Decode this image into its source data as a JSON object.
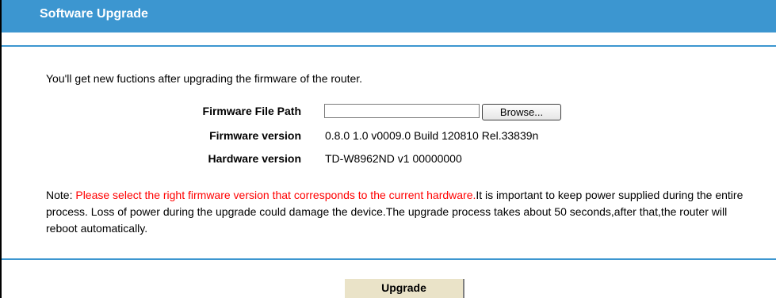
{
  "header": {
    "title": "Software Upgrade"
  },
  "intro": "You'll get new fuctions after upgrading the firmware of the router.",
  "fields": {
    "file_path": {
      "label": "Firmware File Path",
      "value": "",
      "browse_label": "Browse..."
    },
    "firmware_version": {
      "label": "Firmware version",
      "value": "0.8.0 1.0 v0009.0 Build 120810 Rel.33839n"
    },
    "hardware_version": {
      "label": "Hardware version",
      "value": "TD-W8962ND v1 00000000"
    }
  },
  "note": {
    "prefix": "Note: ",
    "warning": "Please select the right firmware version that corresponds to the current hardware.",
    "rest": "It is important to keep power supplied during the entire process. Loss of power during the upgrade could damage the device.The upgrade process takes about 50 seconds,after that,the router will reboot automatically."
  },
  "actions": {
    "upgrade_label": "Upgrade"
  },
  "colors": {
    "header_bg": "#3c96d0",
    "warning_text": "#ff0000",
    "upgrade_button_bg": "#eae3c8"
  }
}
